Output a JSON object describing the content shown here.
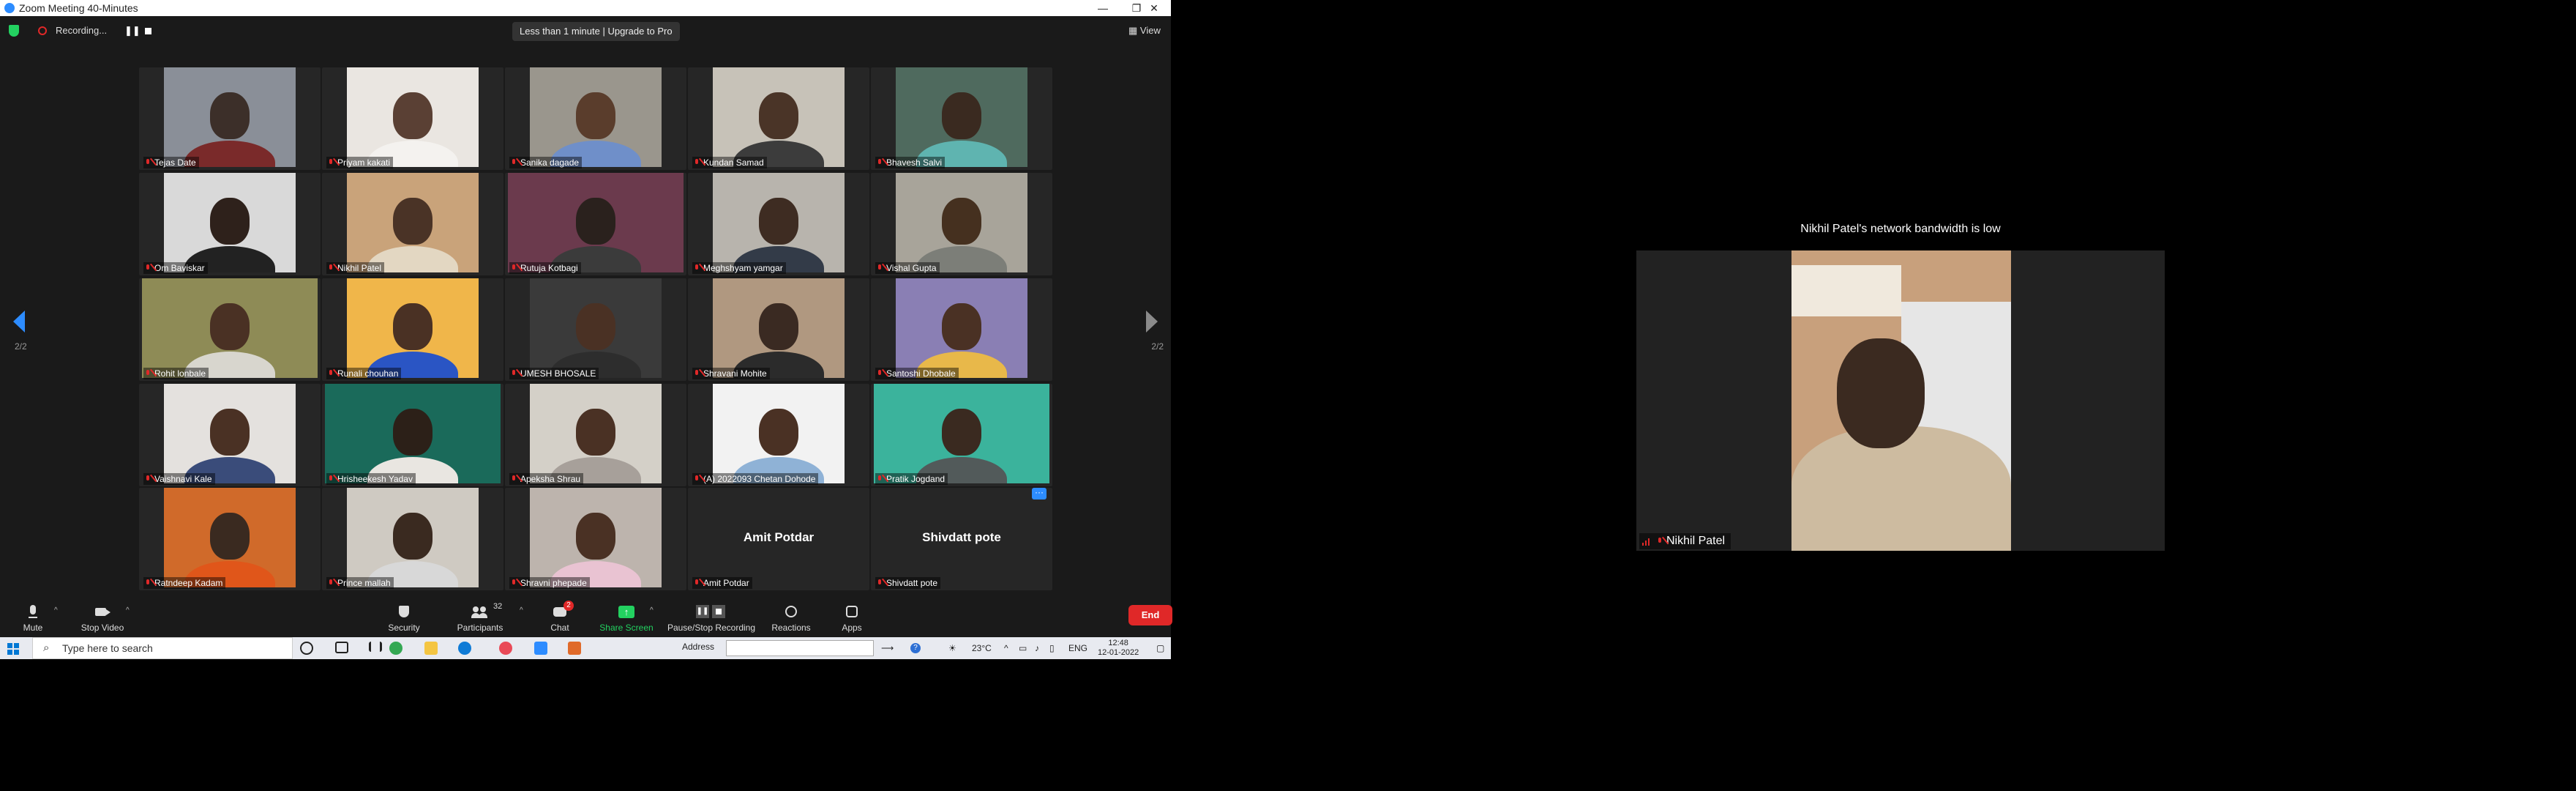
{
  "window": {
    "title": "Zoom Meeting 40-Minutes",
    "controls": [
      "—",
      "❐",
      "✕"
    ]
  },
  "topbar": {
    "recording_label": "Recording...",
    "trial_notice": "Less than 1 minute | Upgrade to Pro",
    "view_label": "View"
  },
  "pagination": {
    "left": "2/2",
    "right": "2/2"
  },
  "participants": [
    {
      "name": "Tejas Date"
    },
    {
      "name": "Priyam kakati"
    },
    {
      "name": "Sanika dagade"
    },
    {
      "name": "Kundan Samad"
    },
    {
      "name": "Bhavesh Salvi"
    },
    {
      "name": "Om Baviskar"
    },
    {
      "name": "Nikhil Patel"
    },
    {
      "name": "Rutuja Kotbagi"
    },
    {
      "name": "Meghshyam yamgar"
    },
    {
      "name": "Vishal Gupta"
    },
    {
      "name": "Rohit lonbale"
    },
    {
      "name": "Runali chouhan"
    },
    {
      "name": "UMESH BHOSALE"
    },
    {
      "name": "Shravani Mohite"
    },
    {
      "name": "Santoshi Dhobale"
    },
    {
      "name": "Vaishnavi Kale"
    },
    {
      "name": "Hrisheekesh Yadav"
    },
    {
      "name": "Apeksha Shrau"
    },
    {
      "name": "(A) 2022093 Chetan Dohode"
    },
    {
      "name": "Pratik Jogdand"
    },
    {
      "name": "Ratndeep Kadam"
    },
    {
      "name": "Prince mallah"
    },
    {
      "name": "Shravni phepade"
    },
    {
      "name": "Amit Potdar",
      "initials": "Amit Potdar"
    },
    {
      "name": "Shivdatt pote",
      "initials": "Shivdatt pote"
    }
  ],
  "toolbar": {
    "mute": "Mute",
    "stop_video": "Stop Video",
    "security": "Security",
    "participants": "Participants",
    "participants_count": "32",
    "chat": "Chat",
    "chat_badge": "2",
    "share_screen": "Share Screen",
    "pause_stop_recording": "Pause/Stop Recording",
    "reactions": "Reactions",
    "apps": "Apps",
    "end": "End"
  },
  "taskbar": {
    "search_placeholder": "Type here to search",
    "address_label": "Address",
    "temperature": "23°C",
    "language": "ENG",
    "time": "12:48",
    "date": "12-01-2022"
  },
  "second_screen": {
    "notice": "Nikhil Patel's network bandwidth is low",
    "speaker_name": "Nikhil Patel"
  },
  "colors": {
    "accent": "#2d8cff",
    "share_green": "#23d160",
    "end_red": "#e02828",
    "bg": "#1a1a1a"
  }
}
